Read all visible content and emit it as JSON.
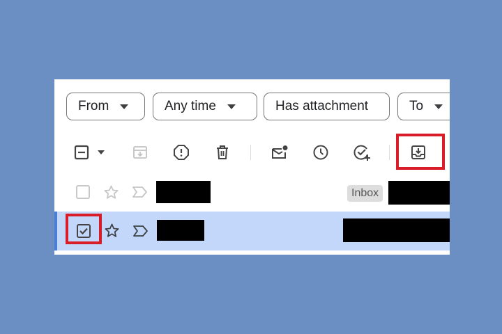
{
  "filters": {
    "from": "From",
    "any_time": "Any time",
    "has_attachment": "Has attachment",
    "to": "To"
  },
  "toolbar": {
    "icons": [
      "select-all-checkbox-icon",
      "archive-icon",
      "report-spam-icon",
      "delete-icon",
      "mark-unread-icon",
      "snooze-icon",
      "add-to-tasks-icon",
      "move-to-inbox-icon"
    ]
  },
  "rows": [
    {
      "label": "Inbox",
      "selected": false,
      "starred": false
    },
    {
      "selected": true,
      "starred": false
    }
  ],
  "colors": {
    "background": "#6b8fc3",
    "selected_row": "#c2d7fa",
    "highlight": "#d81c28",
    "redaction": "#000000"
  }
}
